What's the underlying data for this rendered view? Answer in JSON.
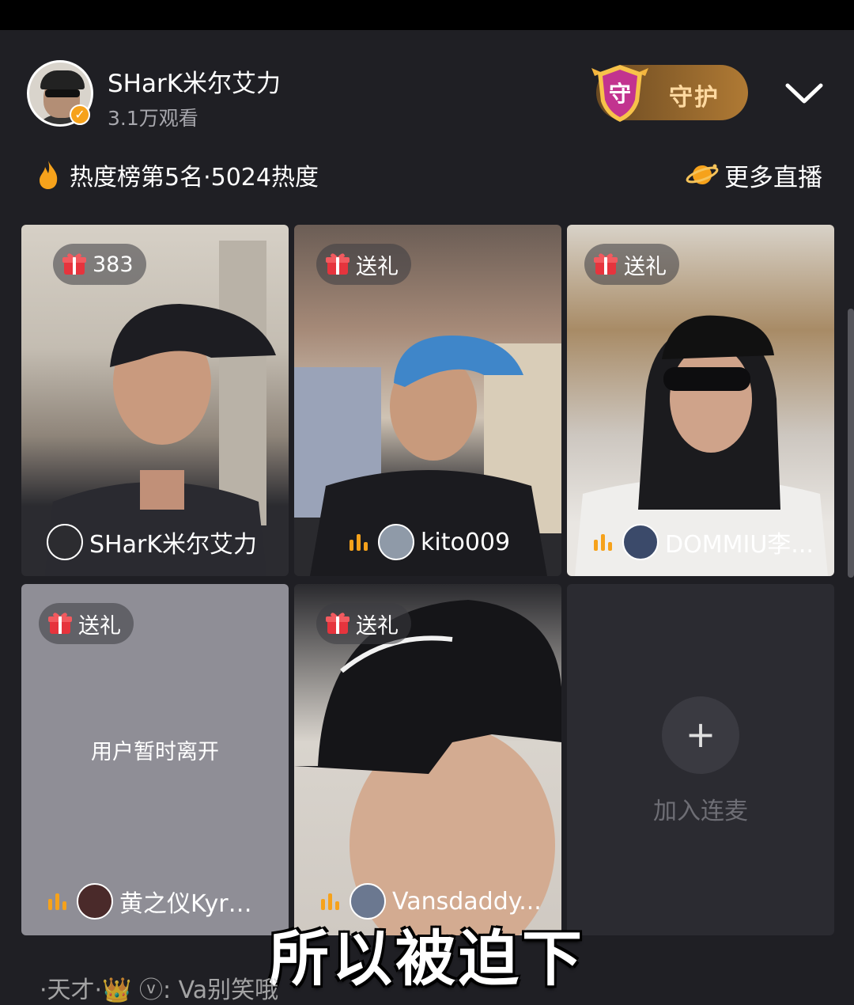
{
  "host": {
    "name": "SHarK米尔艾力",
    "viewers": "3.1万观看",
    "verify_symbol": "✓"
  },
  "guard_button": {
    "badge": "守",
    "label": "守护"
  },
  "heat": {
    "text": "热度榜第5名·5024热度"
  },
  "more_live": {
    "label": "更多直播"
  },
  "tiles": [
    {
      "gift": "383",
      "name": "SHarK米尔艾力",
      "mic": false
    },
    {
      "gift": "送礼",
      "name": "kito009",
      "mic": true
    },
    {
      "gift": "送礼",
      "name": "DOMMIU李...",
      "mic": true
    },
    {
      "gift": "送礼",
      "name": "黄之仪Kyra...",
      "mic": true,
      "status": "用户暂时离开"
    },
    {
      "gift": "送礼",
      "name": "Vansdaddy...",
      "mic": true
    }
  ],
  "join": {
    "symbol": "+",
    "label": "加入连麦"
  },
  "caption": "所以被迫下",
  "bottom_text": "·天才·👑 ⓥ: Va别笑哦",
  "colors": {
    "background": "#1f1f24",
    "accent_orange": "#f6a21b",
    "guard_gold": "#b07a34",
    "gift_red": "#e6343d"
  }
}
